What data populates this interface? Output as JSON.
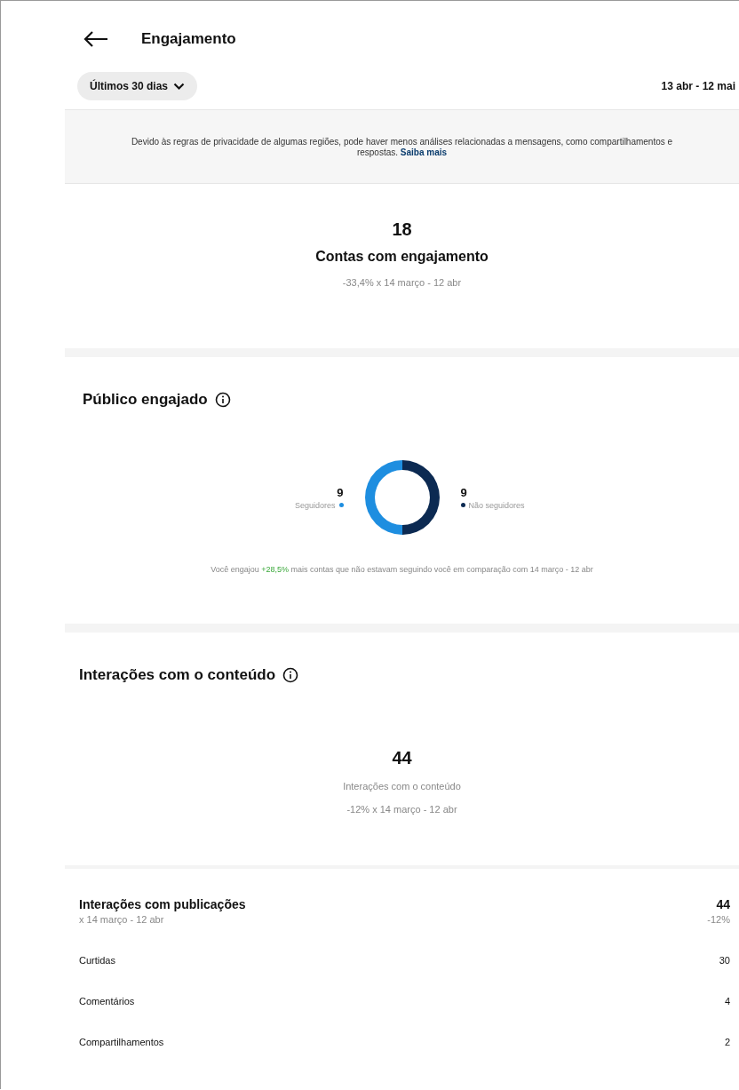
{
  "header": {
    "title": "Engajamento"
  },
  "period": {
    "label": "Últimos 30 dias",
    "range": "13 abr - 12 mai"
  },
  "notice": {
    "text": "Devido às regras de privacidade de algumas regiões, pode haver menos análises relacionadas a mensagens, como compartilhamentos e respostas.",
    "link": "Saiba mais"
  },
  "summary": {
    "value": "18",
    "title": "Contas com engajamento",
    "comparison": "-33,4% x 14 março - 12 abr"
  },
  "audience": {
    "title": "Público engajado",
    "legend": [
      {
        "value": "9",
        "color": "#1e8ee0"
      },
      {
        "value": "9",
        "color": "#0c2a52"
      }
    ],
    "chart_data": {
      "type": "donut",
      "categories": [
        "Seguidores",
        "Não seguidores"
      ],
      "values": [
        50,
        50
      ]
    },
    "note": {
      "before": "Você engajou ",
      "highlight": "+28,5%",
      "after": " mais contas que não estavam seguindo você em comparação com 14 março - 12 abr"
    }
  },
  "content": {
    "title": "Interações com o conteúdo",
    "value": "44",
    "label": "Interações com o conteúdo",
    "comparison": "-12% x 14 março - 12 abr"
  },
  "posts": {
    "title": "Interações com publicações",
    "subtitle": "x 14 março - 12 abr",
    "value": "44",
    "change": "-12%",
    "rows": [
      {
        "label": "Curtidas",
        "value": "30"
      },
      {
        "label": "Comentários",
        "value": "4"
      },
      {
        "label": "Compartilhamentos",
        "value": "2"
      }
    ]
  }
}
